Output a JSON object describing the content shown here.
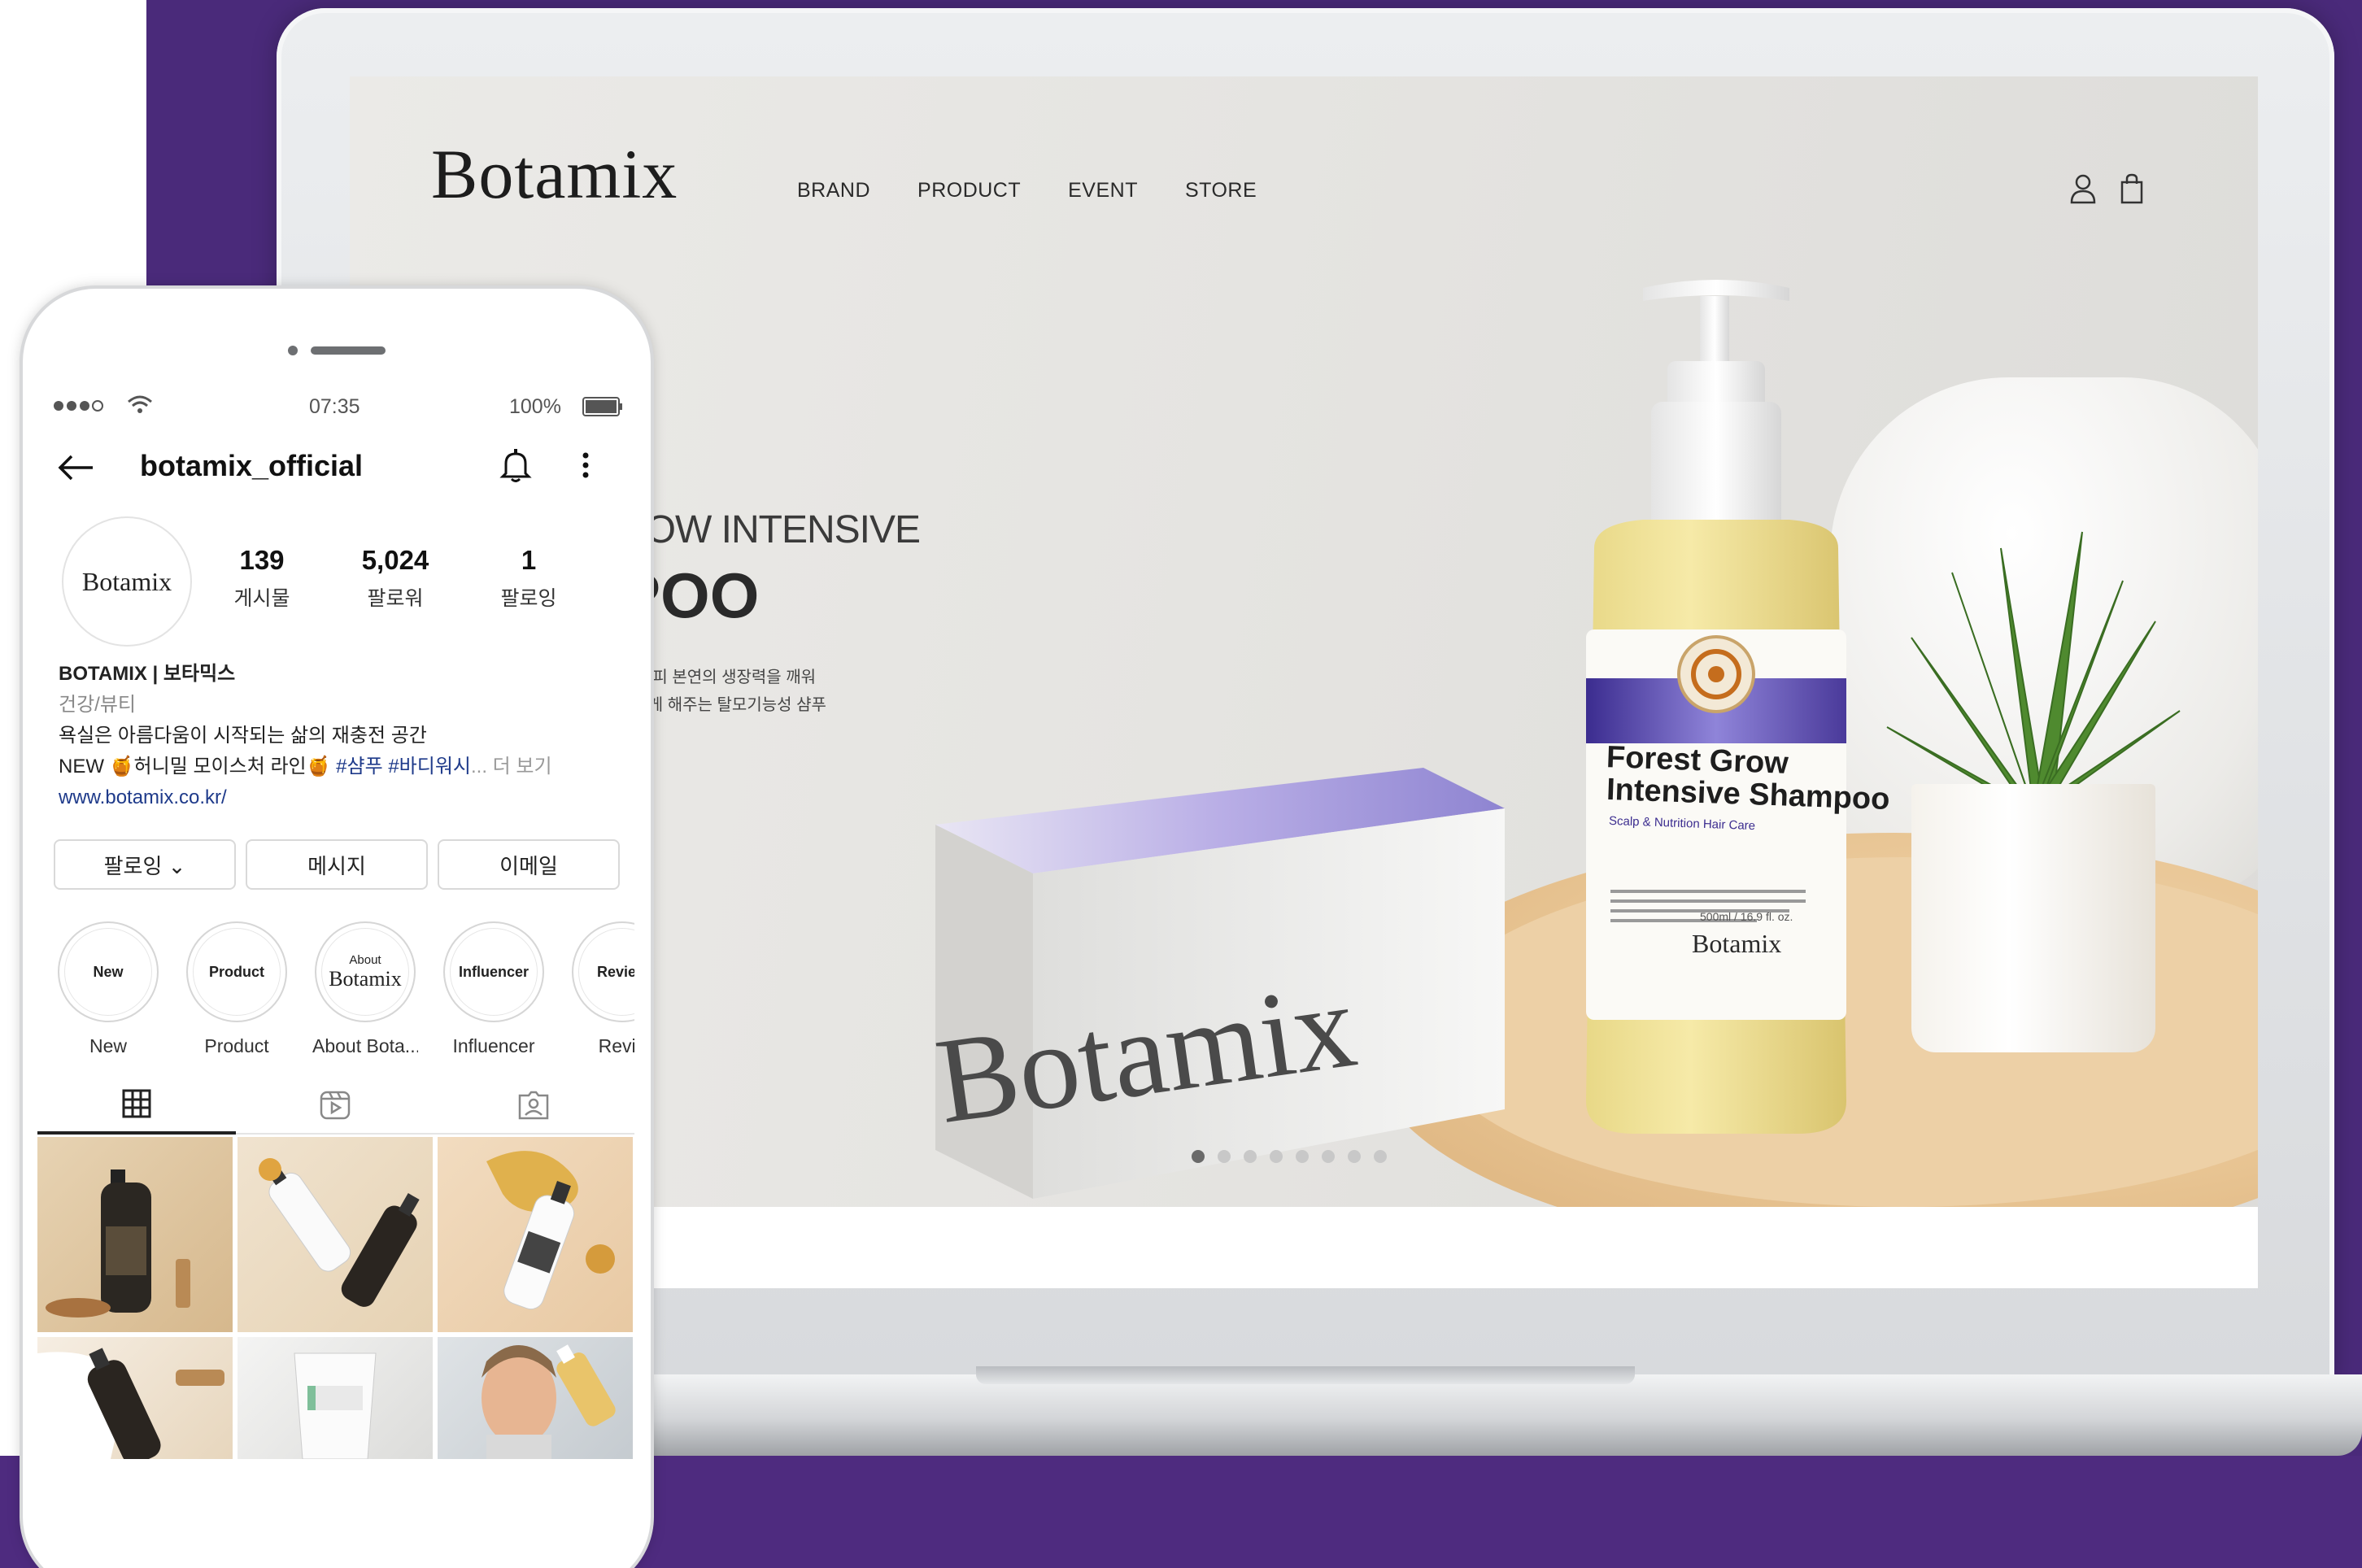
{
  "website": {
    "logo": "Botamix",
    "nav": [
      "BRAND",
      "PRODUCT",
      "EVENT",
      "STORE"
    ],
    "hero": {
      "title_line1": "ROW INTENSIVE",
      "title_line2": "POO",
      "desc_line1": "과 두피 본연의 생장력을 깨워",
      "desc_line2": "고하게 해주는 탈모기능성 샴푸",
      "box_brand": "Botamix"
    },
    "product_label": {
      "name_line1": "Forest Grow",
      "name_line2": "Intensive Shampoo",
      "subtitle": "Scalp & Nutrition Hair Care",
      "volume": "500ml / 16.9 fl. oz.",
      "brand": "Botamix"
    },
    "carousel": {
      "total": 8,
      "active": 1
    }
  },
  "instagram": {
    "status": {
      "time": "07:35",
      "battery": "100%"
    },
    "username": "botamix_official",
    "avatar_text": "Botamix",
    "stats": [
      {
        "value": "139",
        "label": "게시물"
      },
      {
        "value": "5,024",
        "label": "팔로워"
      },
      {
        "value": "1",
        "label": "팔로잉"
      }
    ],
    "bio": {
      "name": "BOTAMIX | 보타믹스",
      "category": "건강/뷰티",
      "line1": "욕실은 아름다움이 시작되는 삶의 재충전 공간",
      "line2_prefix": "NEW 🍯허니밀 모이스처 라인🍯 ",
      "line2_tags": "#샴푸 #바디워시",
      "line2_more": "... 더 보기",
      "link": "www.botamix.co.kr/"
    },
    "buttons": [
      "팔로잉 ⌄",
      "메시지",
      "이메일"
    ],
    "highlights": [
      {
        "ring": "New",
        "caption": "New"
      },
      {
        "ring": "Product",
        "caption": "Product"
      },
      {
        "ring_small": "About",
        "ring": "Botamix",
        "caption": "About Bota..."
      },
      {
        "ring": "Influencer",
        "caption": "Influencer"
      },
      {
        "ring": "Review",
        "caption": "Revie"
      }
    ]
  },
  "colors": {
    "purple": "#4a2a7a",
    "accent_link": "#1e3a8a"
  }
}
